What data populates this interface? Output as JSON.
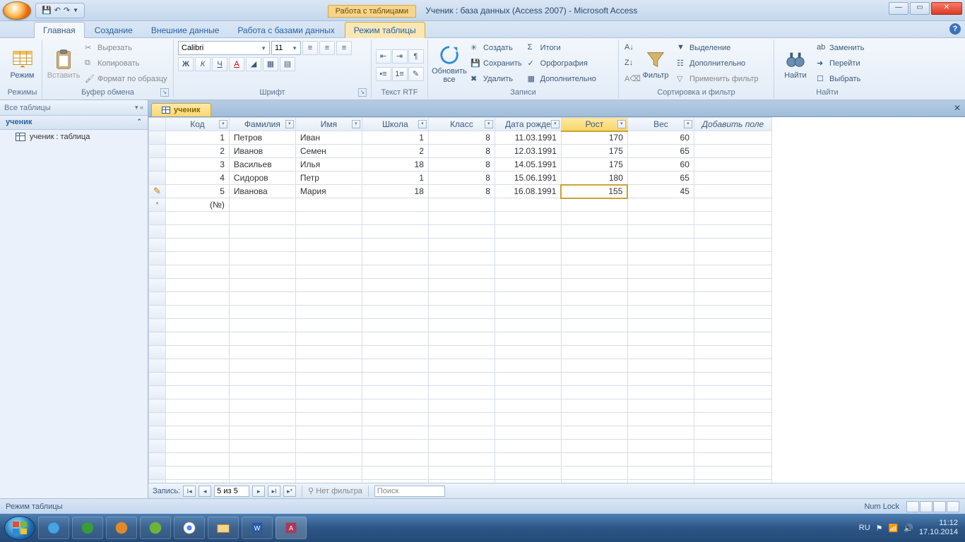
{
  "titlebar": {
    "contextual_label": "Работа с таблицами",
    "doc_title": "Ученик : база данных (Access 2007) - Microsoft Access"
  },
  "ribbon_tabs": {
    "home": "Главная",
    "create": "Создание",
    "external": "Внешние данные",
    "dbtools": "Работа с базами данных",
    "datasheet": "Режим таблицы"
  },
  "ribbon": {
    "views_group": "Режимы",
    "view_btn": "Режим",
    "clipboard_group": "Буфер обмена",
    "paste": "Вставить",
    "cut": "Вырезать",
    "copy": "Копировать",
    "format_painter": "Формат по образцу",
    "font_group": "Шрифт",
    "font_name": "Calibri",
    "font_size": "11",
    "rtf_group": "Текст RTF",
    "records_group": "Записи",
    "refresh": "Обновить все",
    "new": "Создать",
    "save": "Сохранить",
    "delete": "Удалить",
    "totals": "Итоги",
    "spelling": "Орфография",
    "more": "Дополнительно",
    "sortfilter_group": "Сортировка и фильтр",
    "filter": "Фильтр",
    "selection": "Выделение",
    "advanced": "Дополнительно",
    "toggle_filter": "Применить фильтр",
    "find_group": "Найти",
    "find": "Найти",
    "replace": "Заменить",
    "goto": "Перейти",
    "select": "Выбрать"
  },
  "navpane": {
    "header": "Все таблицы",
    "group": "ученик",
    "item": "ученик : таблица"
  },
  "doctab": "ученик",
  "grid": {
    "headers": [
      "Код",
      "Фамилия",
      "Имя",
      "Школа",
      "Класс",
      "Дата рожде",
      "Рост",
      "Вес"
    ],
    "add_field": "Добавить поле",
    "new_row_placeholder": "(№)",
    "rows": [
      {
        "id": "1",
        "fam": "Петров",
        "name": "Иван",
        "school": "1",
        "class": "8",
        "dob": "11.03.1991",
        "h": "170",
        "w": "60"
      },
      {
        "id": "2",
        "fam": "Иванов",
        "name": "Семен",
        "school": "2",
        "class": "8",
        "dob": "12.03.1991",
        "h": "175",
        "w": "65"
      },
      {
        "id": "3",
        "fam": "Васильев",
        "name": "Илья",
        "school": "18",
        "class": "8",
        "dob": "14.05.1991",
        "h": "175",
        "w": "60"
      },
      {
        "id": "4",
        "fam": "Сидоров",
        "name": "Петр",
        "school": "1",
        "class": "8",
        "dob": "15.06.1991",
        "h": "180",
        "w": "65"
      },
      {
        "id": "5",
        "fam": "Иванова",
        "name": "Мария",
        "school": "18",
        "class": "8",
        "dob": "16.08.1991",
        "h": "155",
        "w": "45"
      }
    ]
  },
  "recnav": {
    "label": "Запись:",
    "pos": "5 из 5",
    "nofilter": "Нет фильтра",
    "search": "Поиск"
  },
  "statusbar": {
    "mode": "Режим таблицы",
    "numlock": "Num Lock"
  },
  "taskbar": {
    "lang": "RU",
    "time": "11:12",
    "date": "17.10.2014"
  }
}
